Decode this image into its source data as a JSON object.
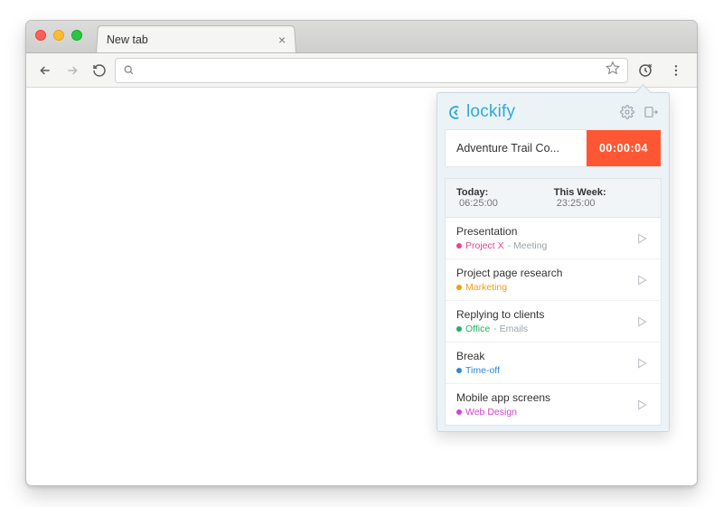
{
  "browser": {
    "tab_title": "New tab",
    "omnibox_value": ""
  },
  "popup": {
    "brand": "lockify",
    "timer": {
      "description": "Adventure Trail Co...",
      "elapsed": "00:00:04"
    },
    "stats": {
      "today_label": "Today:",
      "today_value": "06:25:00",
      "week_label": "This Week:",
      "week_value": "23:25:00"
    },
    "entries": [
      {
        "title": "Presentation",
        "project": "Project X",
        "tag": "Meeting",
        "color": "#e84393"
      },
      {
        "title": "Project page research",
        "project": "Marketing",
        "tag": "",
        "color": "#f39c12"
      },
      {
        "title": "Replying to clients",
        "project": "Office",
        "tag": "Emails",
        "color": "#27ae60"
      },
      {
        "title": "Break",
        "project": "Time-off",
        "tag": "",
        "color": "#2e86de"
      },
      {
        "title": "Mobile app screens",
        "project": "Web Design",
        "tag": "",
        "color": "#d63fd6"
      }
    ]
  }
}
